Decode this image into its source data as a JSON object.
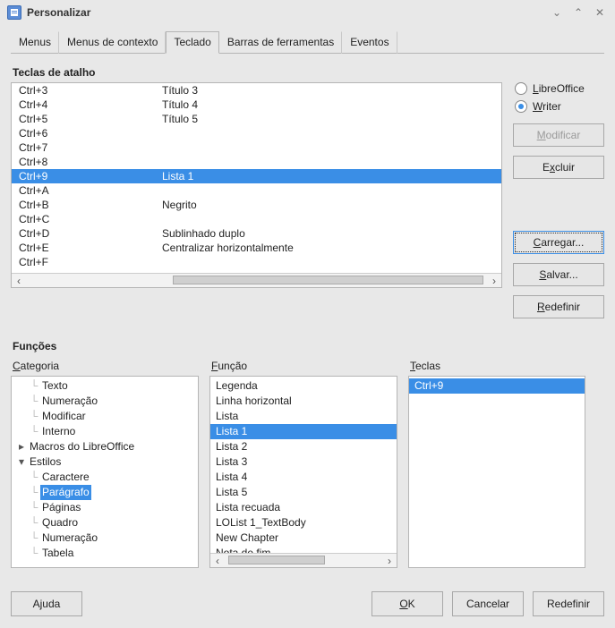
{
  "window": {
    "title": "Personalizar"
  },
  "tabs": [
    "Menus",
    "Menus de contexto",
    "Teclado",
    "Barras de ferramentas",
    "Eventos"
  ],
  "active_tab": 2,
  "section_shortcuts": "Teclas de atalho",
  "shortcuts": [
    {
      "key": "Ctrl+3",
      "cmd": "Título 3"
    },
    {
      "key": "Ctrl+4",
      "cmd": "Título 4"
    },
    {
      "key": "Ctrl+5",
      "cmd": "Título 5"
    },
    {
      "key": "Ctrl+6",
      "cmd": ""
    },
    {
      "key": "Ctrl+7",
      "cmd": ""
    },
    {
      "key": "Ctrl+8",
      "cmd": ""
    },
    {
      "key": "Ctrl+9",
      "cmd": "Lista 1"
    },
    {
      "key": "Ctrl+A",
      "cmd": ""
    },
    {
      "key": "Ctrl+B",
      "cmd": "Negrito"
    },
    {
      "key": "Ctrl+C",
      "cmd": ""
    },
    {
      "key": "Ctrl+D",
      "cmd": "Sublinhado duplo"
    },
    {
      "key": "Ctrl+E",
      "cmd": "Centralizar horizontalmente"
    },
    {
      "key": "Ctrl+F",
      "cmd": ""
    }
  ],
  "shortcut_selected": 6,
  "radios": {
    "libreoffice": "LibreOffice",
    "writer": "Writer",
    "selected": "writer"
  },
  "buttons": {
    "modify": "Modificar",
    "delete": "Excluir",
    "load": "Carregar...",
    "save": "Salvar...",
    "reset": "Redefinir"
  },
  "section_functions": "Funções",
  "labels": {
    "category": "Categoria",
    "function": "Função",
    "keys": "Teclas"
  },
  "category_tree": [
    {
      "label": "Texto",
      "depth": 1
    },
    {
      "label": "Numeração",
      "depth": 1
    },
    {
      "label": "Modificar",
      "depth": 1
    },
    {
      "label": "Interno",
      "depth": 1
    },
    {
      "label": "Macros do LibreOffice",
      "depth": 0,
      "twisty": "right"
    },
    {
      "label": "Estilos",
      "depth": 0,
      "twisty": "down"
    },
    {
      "label": "Caractere",
      "depth": 1
    },
    {
      "label": "Parágrafo",
      "depth": 1,
      "selected": true
    },
    {
      "label": "Páginas",
      "depth": 1
    },
    {
      "label": "Quadro",
      "depth": 1
    },
    {
      "label": "Numeração",
      "depth": 1
    },
    {
      "label": "Tabela",
      "depth": 1
    }
  ],
  "function_list": [
    "Legenda",
    "Linha horizontal",
    "Lista",
    "Lista 1",
    "Lista 2",
    "Lista 3",
    "Lista 4",
    "Lista 5",
    "Lista recuada",
    "LOList 1_TextBody",
    "New Chapter",
    "Nota de fim"
  ],
  "function_selected": 3,
  "keys_list": [
    "Ctrl+9"
  ],
  "keys_selected": 0,
  "footer": {
    "help": "Ajuda",
    "ok": "OK",
    "cancel": "Cancelar",
    "reset": "Redefinir"
  }
}
